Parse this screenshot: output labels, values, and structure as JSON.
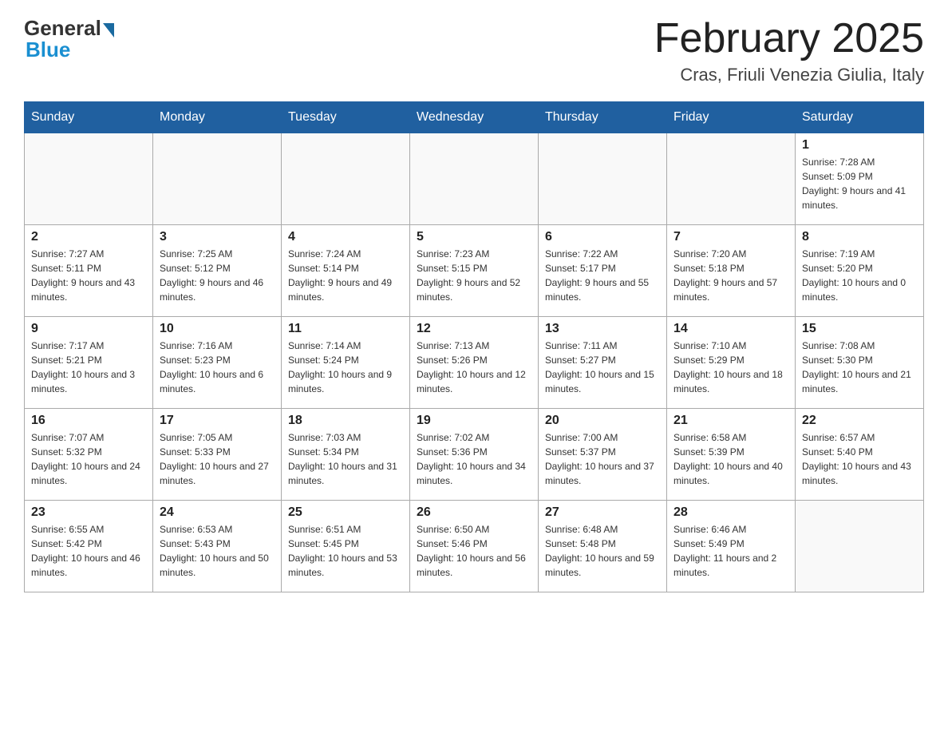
{
  "header": {
    "logo_general": "General",
    "logo_blue": "Blue",
    "month_title": "February 2025",
    "location": "Cras, Friuli Venezia Giulia, Italy"
  },
  "weekdays": [
    "Sunday",
    "Monday",
    "Tuesday",
    "Wednesday",
    "Thursday",
    "Friday",
    "Saturday"
  ],
  "weeks": [
    [
      {
        "day": "",
        "empty": true
      },
      {
        "day": "",
        "empty": true
      },
      {
        "day": "",
        "empty": true
      },
      {
        "day": "",
        "empty": true
      },
      {
        "day": "",
        "empty": true
      },
      {
        "day": "",
        "empty": true
      },
      {
        "day": "1",
        "sunrise": "7:28 AM",
        "sunset": "5:09 PM",
        "daylight": "9 hours and 41 minutes."
      }
    ],
    [
      {
        "day": "2",
        "sunrise": "7:27 AM",
        "sunset": "5:11 PM",
        "daylight": "9 hours and 43 minutes."
      },
      {
        "day": "3",
        "sunrise": "7:25 AM",
        "sunset": "5:12 PM",
        "daylight": "9 hours and 46 minutes."
      },
      {
        "day": "4",
        "sunrise": "7:24 AM",
        "sunset": "5:14 PM",
        "daylight": "9 hours and 49 minutes."
      },
      {
        "day": "5",
        "sunrise": "7:23 AM",
        "sunset": "5:15 PM",
        "daylight": "9 hours and 52 minutes."
      },
      {
        "day": "6",
        "sunrise": "7:22 AM",
        "sunset": "5:17 PM",
        "daylight": "9 hours and 55 minutes."
      },
      {
        "day": "7",
        "sunrise": "7:20 AM",
        "sunset": "5:18 PM",
        "daylight": "9 hours and 57 minutes."
      },
      {
        "day": "8",
        "sunrise": "7:19 AM",
        "sunset": "5:20 PM",
        "daylight": "10 hours and 0 minutes."
      }
    ],
    [
      {
        "day": "9",
        "sunrise": "7:17 AM",
        "sunset": "5:21 PM",
        "daylight": "10 hours and 3 minutes."
      },
      {
        "day": "10",
        "sunrise": "7:16 AM",
        "sunset": "5:23 PM",
        "daylight": "10 hours and 6 minutes."
      },
      {
        "day": "11",
        "sunrise": "7:14 AM",
        "sunset": "5:24 PM",
        "daylight": "10 hours and 9 minutes."
      },
      {
        "day": "12",
        "sunrise": "7:13 AM",
        "sunset": "5:26 PM",
        "daylight": "10 hours and 12 minutes."
      },
      {
        "day": "13",
        "sunrise": "7:11 AM",
        "sunset": "5:27 PM",
        "daylight": "10 hours and 15 minutes."
      },
      {
        "day": "14",
        "sunrise": "7:10 AM",
        "sunset": "5:29 PM",
        "daylight": "10 hours and 18 minutes."
      },
      {
        "day": "15",
        "sunrise": "7:08 AM",
        "sunset": "5:30 PM",
        "daylight": "10 hours and 21 minutes."
      }
    ],
    [
      {
        "day": "16",
        "sunrise": "7:07 AM",
        "sunset": "5:32 PM",
        "daylight": "10 hours and 24 minutes."
      },
      {
        "day": "17",
        "sunrise": "7:05 AM",
        "sunset": "5:33 PM",
        "daylight": "10 hours and 27 minutes."
      },
      {
        "day": "18",
        "sunrise": "7:03 AM",
        "sunset": "5:34 PM",
        "daylight": "10 hours and 31 minutes."
      },
      {
        "day": "19",
        "sunrise": "7:02 AM",
        "sunset": "5:36 PM",
        "daylight": "10 hours and 34 minutes."
      },
      {
        "day": "20",
        "sunrise": "7:00 AM",
        "sunset": "5:37 PM",
        "daylight": "10 hours and 37 minutes."
      },
      {
        "day": "21",
        "sunrise": "6:58 AM",
        "sunset": "5:39 PM",
        "daylight": "10 hours and 40 minutes."
      },
      {
        "day": "22",
        "sunrise": "6:57 AM",
        "sunset": "5:40 PM",
        "daylight": "10 hours and 43 minutes."
      }
    ],
    [
      {
        "day": "23",
        "sunrise": "6:55 AM",
        "sunset": "5:42 PM",
        "daylight": "10 hours and 46 minutes."
      },
      {
        "day": "24",
        "sunrise": "6:53 AM",
        "sunset": "5:43 PM",
        "daylight": "10 hours and 50 minutes."
      },
      {
        "day": "25",
        "sunrise": "6:51 AM",
        "sunset": "5:45 PM",
        "daylight": "10 hours and 53 minutes."
      },
      {
        "day": "26",
        "sunrise": "6:50 AM",
        "sunset": "5:46 PM",
        "daylight": "10 hours and 56 minutes."
      },
      {
        "day": "27",
        "sunrise": "6:48 AM",
        "sunset": "5:48 PM",
        "daylight": "10 hours and 59 minutes."
      },
      {
        "day": "28",
        "sunrise": "6:46 AM",
        "sunset": "5:49 PM",
        "daylight": "11 hours and 2 minutes."
      },
      {
        "day": "",
        "empty": true
      }
    ]
  ]
}
